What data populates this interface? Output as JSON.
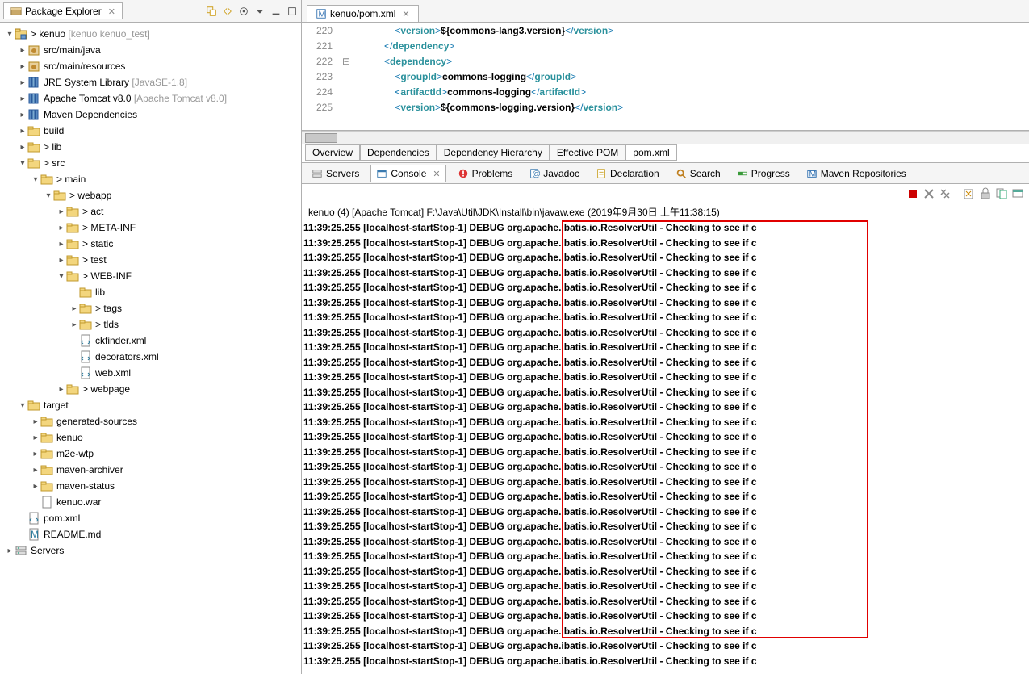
{
  "packageExplorer": {
    "title": "Package Explorer",
    "nodes": [
      {
        "indent": 0,
        "twisty": "▾",
        "icon": "project",
        "label": "> kenuo ",
        "decor": "[kenuo kenuo_test]"
      },
      {
        "indent": 1,
        "twisty": "▸",
        "icon": "pkg",
        "label": "src/main/java"
      },
      {
        "indent": 1,
        "twisty": "▸",
        "icon": "pkg",
        "label": "src/main/resources"
      },
      {
        "indent": 1,
        "twisty": "▸",
        "icon": "lib",
        "label": "JRE System Library ",
        "decor": "[JavaSE-1.8]"
      },
      {
        "indent": 1,
        "twisty": "▸",
        "icon": "lib",
        "label": "Apache Tomcat v8.0 ",
        "decor": "[Apache Tomcat v8.0]"
      },
      {
        "indent": 1,
        "twisty": "▸",
        "icon": "lib",
        "label": "Maven Dependencies"
      },
      {
        "indent": 1,
        "twisty": "▸",
        "icon": "folder",
        "label": "build"
      },
      {
        "indent": 1,
        "twisty": "▸",
        "icon": "folder",
        "label": "> lib"
      },
      {
        "indent": 1,
        "twisty": "▾",
        "icon": "folder",
        "label": "> src"
      },
      {
        "indent": 2,
        "twisty": "▾",
        "icon": "folder",
        "label": "> main"
      },
      {
        "indent": 3,
        "twisty": "▾",
        "icon": "folder",
        "label": "> webapp"
      },
      {
        "indent": 4,
        "twisty": "▸",
        "icon": "folder",
        "label": "> act"
      },
      {
        "indent": 4,
        "twisty": "▸",
        "icon": "folder",
        "label": "> META-INF"
      },
      {
        "indent": 4,
        "twisty": "▸",
        "icon": "folder",
        "label": "> static"
      },
      {
        "indent": 4,
        "twisty": "▸",
        "icon": "folder",
        "label": "> test"
      },
      {
        "indent": 4,
        "twisty": "▾",
        "icon": "folder",
        "label": "> WEB-INF"
      },
      {
        "indent": 5,
        "twisty": " ",
        "icon": "folder",
        "label": "lib"
      },
      {
        "indent": 5,
        "twisty": "▸",
        "icon": "folder",
        "label": "> tags"
      },
      {
        "indent": 5,
        "twisty": "▸",
        "icon": "folder",
        "label": "> tlds"
      },
      {
        "indent": 5,
        "twisty": " ",
        "icon": "xml",
        "label": "ckfinder.xml"
      },
      {
        "indent": 5,
        "twisty": " ",
        "icon": "xml",
        "label": "decorators.xml"
      },
      {
        "indent": 5,
        "twisty": " ",
        "icon": "xml",
        "label": "web.xml"
      },
      {
        "indent": 4,
        "twisty": "▸",
        "icon": "folder",
        "label": "> webpage"
      },
      {
        "indent": 1,
        "twisty": "▾",
        "icon": "folder",
        "label": "target"
      },
      {
        "indent": 2,
        "twisty": "▸",
        "icon": "folder",
        "label": "generated-sources"
      },
      {
        "indent": 2,
        "twisty": "▸",
        "icon": "folder",
        "label": "kenuo"
      },
      {
        "indent": 2,
        "twisty": "▸",
        "icon": "folder",
        "label": "m2e-wtp"
      },
      {
        "indent": 2,
        "twisty": "▸",
        "icon": "folder",
        "label": "maven-archiver"
      },
      {
        "indent": 2,
        "twisty": "▸",
        "icon": "folder",
        "label": "maven-status"
      },
      {
        "indent": 2,
        "twisty": " ",
        "icon": "file",
        "label": "kenuo.war"
      },
      {
        "indent": 1,
        "twisty": " ",
        "icon": "xml",
        "label": "pom.xml"
      },
      {
        "indent": 1,
        "twisty": " ",
        "icon": "md",
        "label": "README.md"
      },
      {
        "indent": 0,
        "twisty": "▸",
        "icon": "servers",
        "label": "Servers"
      }
    ]
  },
  "editor": {
    "tab": "kenuo/pom.xml",
    "lines": [
      {
        "no": "220",
        "fold": " ",
        "pre": "                ",
        "segs": [
          [
            "<",
            "tag-blue"
          ],
          [
            "version",
            "tag-teal"
          ],
          [
            ">",
            "tag-blue"
          ],
          [
            "${commons-lang3.version}",
            "txt-bold"
          ],
          [
            "</",
            "tag-blue"
          ],
          [
            "version",
            "tag-teal"
          ],
          [
            ">",
            "tag-blue"
          ]
        ]
      },
      {
        "no": "221",
        "fold": " ",
        "pre": "            ",
        "segs": [
          [
            "</",
            "tag-blue"
          ],
          [
            "dependency",
            "tag-teal"
          ],
          [
            ">",
            "tag-blue"
          ]
        ]
      },
      {
        "no": "222",
        "fold": "⊟",
        "pre": "            ",
        "segs": [
          [
            "<",
            "tag-blue"
          ],
          [
            "dependency",
            "tag-teal"
          ],
          [
            ">",
            "tag-blue"
          ]
        ]
      },
      {
        "no": "223",
        "fold": " ",
        "pre": "                ",
        "segs": [
          [
            "<",
            "tag-blue"
          ],
          [
            "groupId",
            "tag-teal"
          ],
          [
            ">",
            "tag-blue"
          ],
          [
            "commons-logging",
            "txt-bold"
          ],
          [
            "</",
            "tag-blue"
          ],
          [
            "groupId",
            "tag-teal"
          ],
          [
            ">",
            "tag-blue"
          ]
        ]
      },
      {
        "no": "224",
        "fold": " ",
        "pre": "                ",
        "segs": [
          [
            "<",
            "tag-blue"
          ],
          [
            "artifactId",
            "tag-teal"
          ],
          [
            ">",
            "tag-blue"
          ],
          [
            "commons-logging",
            "txt-bold"
          ],
          [
            "</",
            "tag-blue"
          ],
          [
            "artifactId",
            "tag-teal"
          ],
          [
            ">",
            "tag-blue"
          ]
        ]
      },
      {
        "no": "225",
        "fold": " ",
        "pre": "                ",
        "segs": [
          [
            "<",
            "tag-blue"
          ],
          [
            "version",
            "tag-teal"
          ],
          [
            ">",
            "tag-blue"
          ],
          [
            "${commons-logging.version}",
            "txt-bold"
          ],
          [
            "</",
            "tag-blue"
          ],
          [
            "version",
            "tag-teal"
          ],
          [
            ">",
            "tag-blue"
          ]
        ]
      }
    ],
    "bottomTabs": [
      "Overview",
      "Dependencies",
      "Dependency Hierarchy",
      "Effective POM",
      "pom.xml"
    ],
    "bottomSel": 4
  },
  "views": {
    "items": [
      "Servers",
      "Console",
      "Problems",
      "Javadoc",
      "Declaration",
      "Search",
      "Progress",
      "Maven Repositories"
    ],
    "sel": 1
  },
  "console": {
    "title": "kenuo (4) [Apache Tomcat] F:\\Java\\Util\\JDK\\Install\\bin\\javaw.exe (2019年9月30日 上午11:38:15)",
    "rowCountBoxed": 28,
    "rowCountUnboxed": 2,
    "lineText": "11:39:25.255 [localhost-startStop-1] DEBUG org.apache.ibatis.io.ResolverUtil - Checking to see if c"
  }
}
